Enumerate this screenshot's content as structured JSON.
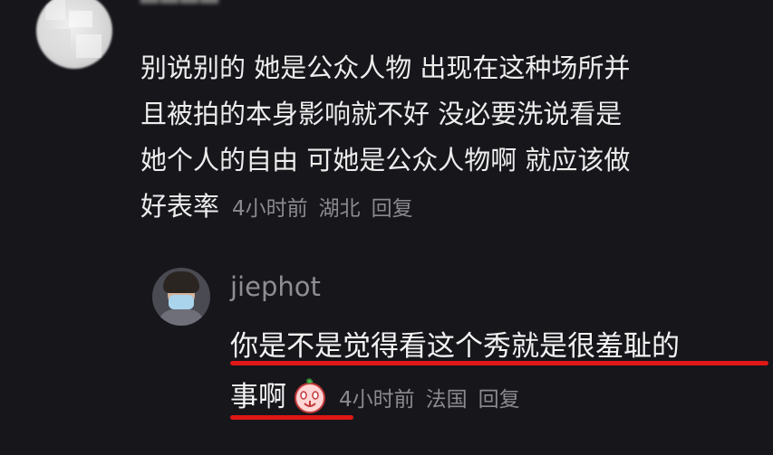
{
  "comment": {
    "lines": [
      "别说别的 她是公众人物 出现在这种场所并",
      "且被拍的本身影响就不好 没必要洗说看是",
      "她个人的自由 可她是公众人物啊 就应该做",
      "好表率"
    ],
    "time": "4小时前",
    "location": "湖北",
    "reply_label": "回复"
  },
  "reply": {
    "username": "jiephot",
    "lines": [
      "你是不是觉得看这个秀就是很羞耻的",
      "事啊"
    ],
    "emoji_icon": "peach-face-emoji-icon",
    "time": "4小时前",
    "location": "法国",
    "reply_label": "回复"
  },
  "colors": {
    "background": "#17161b",
    "text": "#ededed",
    "meta": "#8a8a8f",
    "underline": "#e01717"
  }
}
